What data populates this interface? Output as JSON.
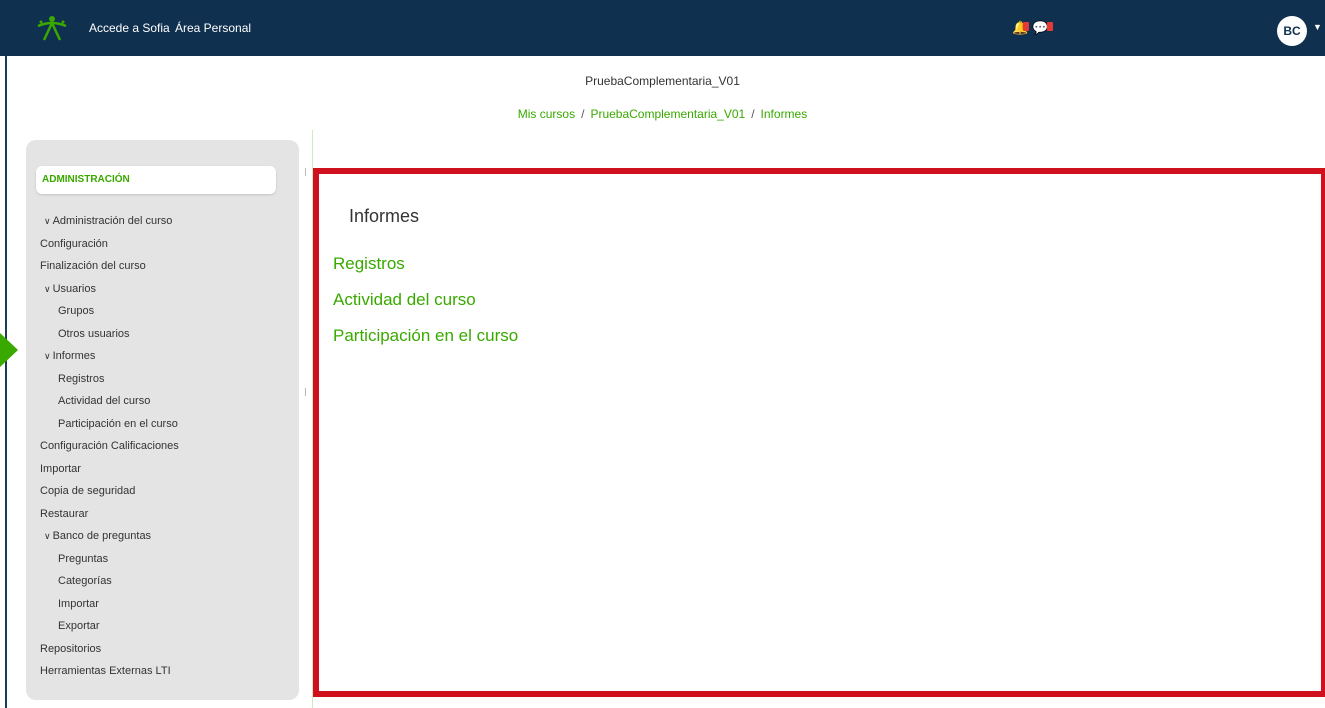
{
  "navbar": {
    "links": [
      "Accede a Sofia",
      "Área Personal"
    ],
    "logo_icon": "sena-logo-icon",
    "notification_icon": "bell-icon",
    "messages_icon": "chat-icon",
    "avatar_initials": "BC",
    "background": "#10304f"
  },
  "page": {
    "title": "PruebaComplementaria_V01",
    "breadcrumb": [
      "Mis cursos",
      "PruebaComplementaria_V01",
      "Informes"
    ]
  },
  "sidebar": {
    "header": "ADMINISTRACIÓN",
    "items": [
      {
        "label": "Administración del curso",
        "expanded": true
      },
      {
        "label": "Configuración"
      },
      {
        "label": "Finalización del curso"
      },
      {
        "label": "Usuarios",
        "expanded": true
      },
      {
        "label": "Grupos"
      },
      {
        "label": "Otros usuarios"
      },
      {
        "label": "Informes",
        "expanded": true
      },
      {
        "label": "Registros"
      },
      {
        "label": "Actividad del curso"
      },
      {
        "label": "Participación en el curso"
      },
      {
        "label": "Configuración Calificaciones"
      },
      {
        "label": "Importar"
      },
      {
        "label": "Copia de seguridad"
      },
      {
        "label": "Restaurar"
      },
      {
        "label": "Banco de preguntas",
        "expanded": true
      },
      {
        "label": "Preguntas"
      },
      {
        "label": "Categorías"
      },
      {
        "label": "Importar"
      },
      {
        "label": "Exportar"
      },
      {
        "label": "Repositorios"
      },
      {
        "label": "Herramientas Externas LTI"
      }
    ]
  },
  "main": {
    "heading": "Informes",
    "links": [
      "Registros",
      "Actividad del curso",
      "Participación en el curso"
    ]
  },
  "colors": {
    "accent_green": "#39a900",
    "highlight_red": "#d0101c"
  }
}
